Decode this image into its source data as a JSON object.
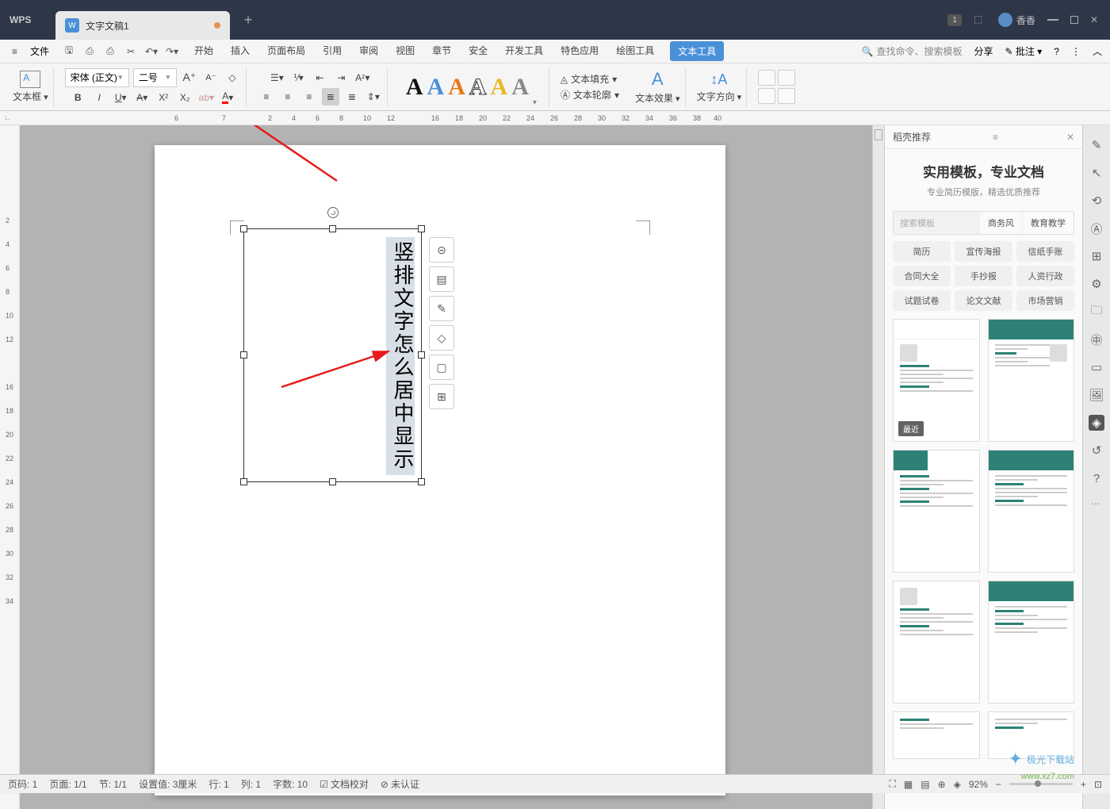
{
  "app": {
    "name": "WPS"
  },
  "tab": {
    "title": "文字文稿1"
  },
  "titlebar": {
    "badge_count": "1",
    "username": "香香"
  },
  "menu": {
    "file": "文件",
    "tabs": [
      "开始",
      "插入",
      "页面布局",
      "引用",
      "审阅",
      "视图",
      "章节",
      "安全",
      "开发工具",
      "特色应用",
      "绘图工具",
      "文本工具"
    ],
    "search_placeholder": "查找命令、搜索模板",
    "share": "分享",
    "annotate": "批注"
  },
  "toolbar": {
    "textbox_label": "文本框",
    "font_name": "宋体 (正文)",
    "font_size": "二号",
    "fill_label": "文本填充",
    "outline_label": "文本轮廓",
    "effect_label": "文本效果",
    "direction_label": "文字方向"
  },
  "text_styles_colors": [
    "#111",
    "#4a90d9",
    "#e67817",
    "#555",
    "#e8b923",
    "#888"
  ],
  "document": {
    "vertical_text": "竖排文字怎么居中显示"
  },
  "ruler_h": [
    "6",
    "7",
    "",
    "2",
    "4",
    "6",
    "8",
    "10",
    "12",
    "",
    "16",
    "18",
    "20",
    "22",
    "24",
    "26",
    "28",
    "30",
    "32",
    "34",
    "36",
    "38",
    "40"
  ],
  "ruler_v": [
    "",
    "2",
    "4",
    "6",
    "8",
    "10",
    "12",
    "",
    "16",
    "18",
    "20",
    "22",
    "24",
    "26",
    "28",
    "30",
    "32",
    "34"
  ],
  "sidepanel": {
    "title": "稻壳推荐",
    "banner_title": "实用模板，专业文档",
    "banner_sub": "专业简历模版，精选优质推荐",
    "search_placeholder": "搜索模板",
    "search_tags": [
      "商务风",
      "教育教学"
    ],
    "categories": [
      "简历",
      "宣传海报",
      "信纸手账",
      "合同大全",
      "手抄报",
      "人资行政",
      "试题试卷",
      "论文文献",
      "市场营销"
    ],
    "recent_badge": "最近"
  },
  "statusbar": {
    "page_no": "页码: 1",
    "page": "页面: 1/1",
    "section": "节: 1/1",
    "pos": "设置值: 3厘米",
    "line": "行: 1",
    "col": "列: 1",
    "words": "字数: 10",
    "proof": "文档校对",
    "auth": "未认证",
    "zoom": "92%"
  },
  "watermark": {
    "main": "极光下载站",
    "url": "www.xz7.com"
  }
}
